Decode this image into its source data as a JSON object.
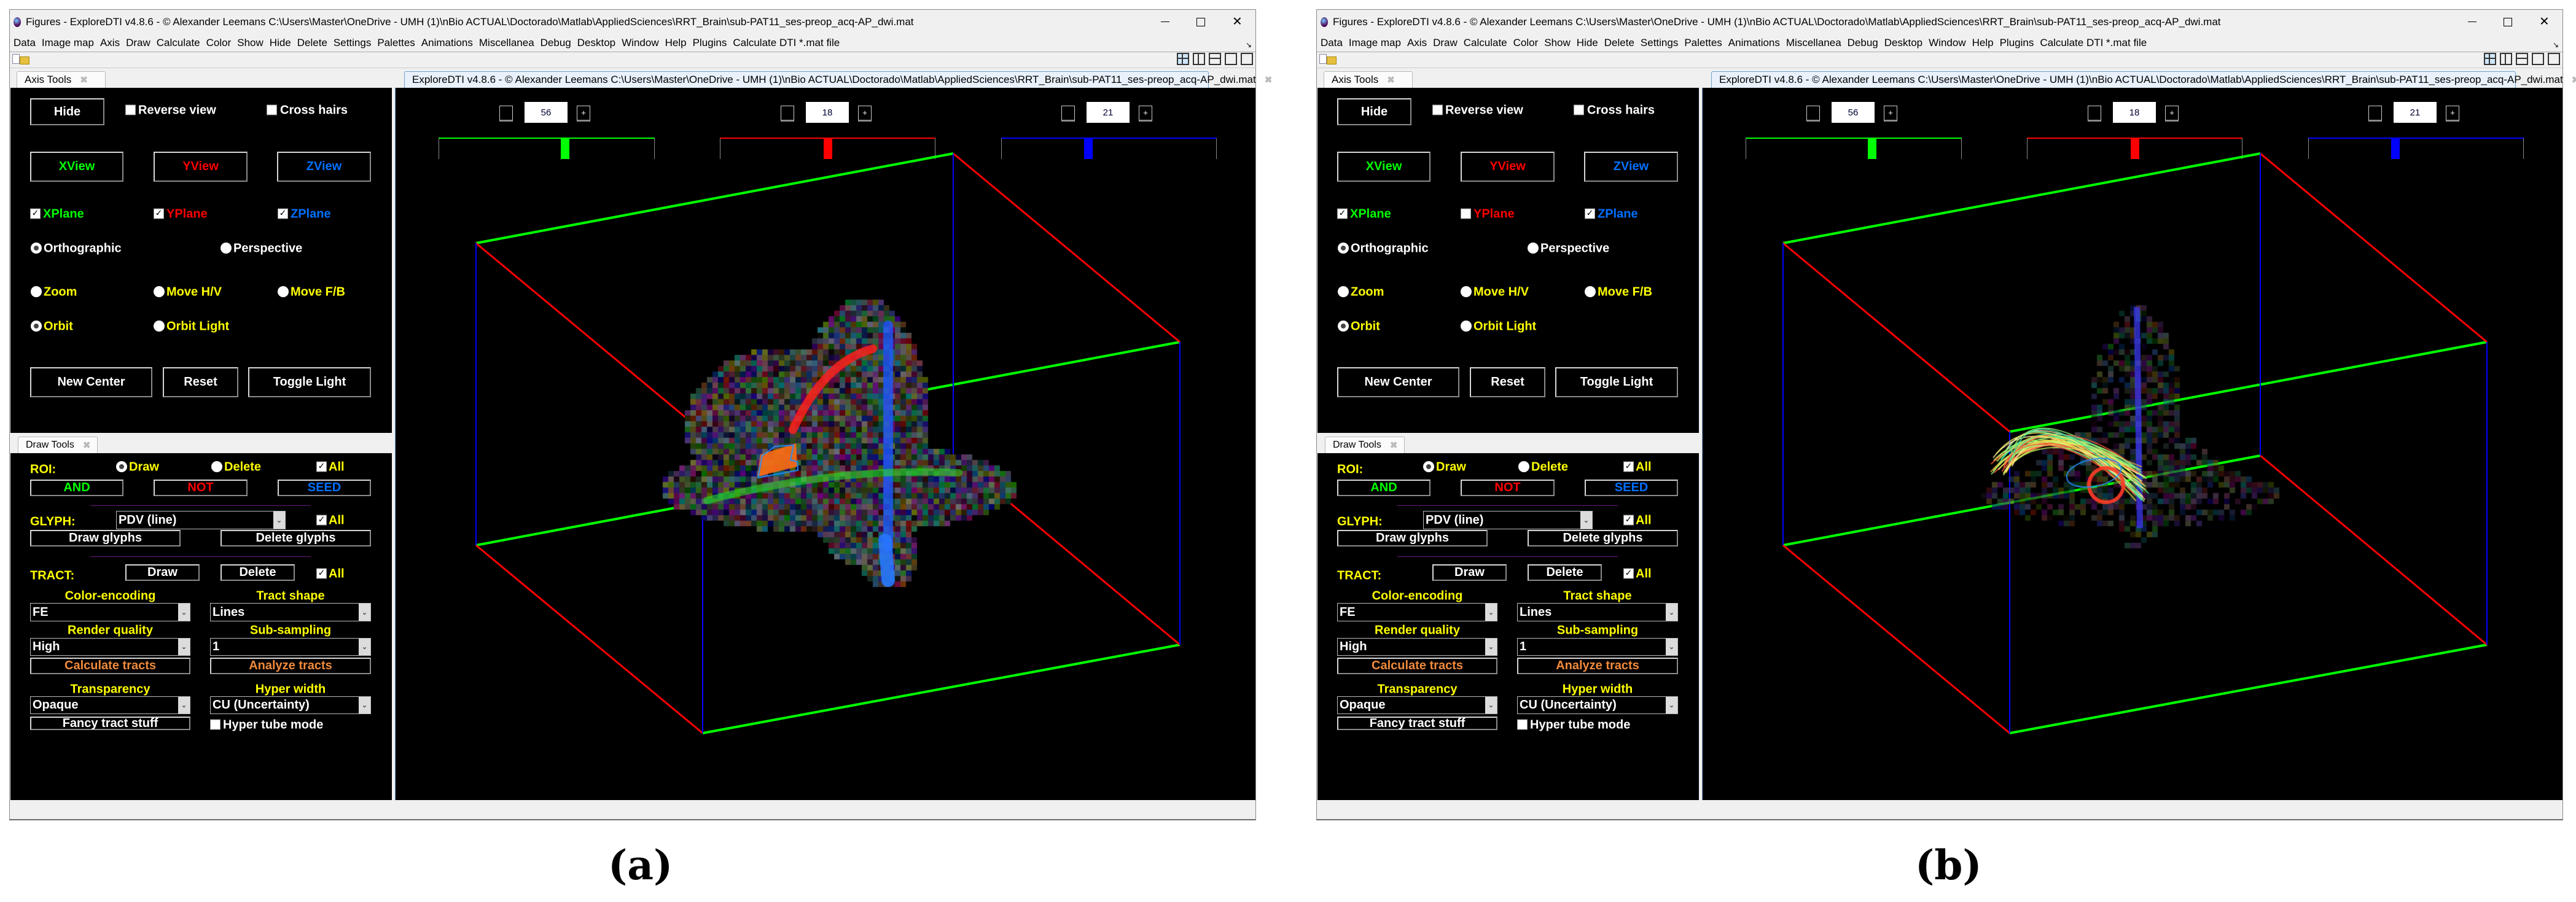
{
  "window": {
    "app_title": "Figures - ExploreDTI v4.8.6 - © Alexander Leemans   C:\\Users\\Master\\OneDrive - UMH (1)\\nBio ACTUAL\\Doctorado\\Matlab\\AppliedSciences\\RRT_Brain\\sub-PAT11_ses-preop_acq-AP_dwi.mat",
    "menu": [
      "Data",
      "Image map",
      "Axis",
      "Draw",
      "Calculate",
      "Color",
      "Show",
      "Hide",
      "Delete",
      "Settings",
      "Palettes",
      "Animations",
      "Miscellanea",
      "Debug",
      "Desktop",
      "Window",
      "Help",
      "Plugins",
      "Calculate DTI *.mat file"
    ],
    "axis_tools_tab": "Axis Tools",
    "draw_tools_tab": "Draw Tools",
    "view_tab": "ExploreDTI v4.8.6 - © Alexander Leemans   C:\\Users\\Master\\OneDrive - UMH (1)\\nBio ACTUAL\\Doctorado\\Matlab\\AppliedSciences\\RRT_Brain\\sub-PAT11_ses-preop_acq-AP_dwi.mat",
    "tab_close": "✖",
    "slice_minus": "",
    "slice_plus": "+"
  },
  "ui": {
    "axis": {
      "hide": "Hide",
      "reverse_view": "Reverse view",
      "cross_hairs": "Cross hairs",
      "xview": "XView",
      "yview": "YView",
      "zview": "ZView",
      "xplane": "XPlane",
      "yplane": "YPlane",
      "zplane": "ZPlane",
      "orthographic": "Orthographic",
      "perspective": "Perspective",
      "zoom": "Zoom",
      "move_hv": "Move H/V",
      "move_fb": "Move F/B",
      "orbit": "Orbit",
      "orbit_light": "Orbit Light",
      "new_center": "New Center",
      "reset": "Reset",
      "toggle_light": "Toggle Light"
    },
    "draw": {
      "roi": "ROI:",
      "draw": "Draw",
      "delete": "Delete",
      "all": "All",
      "and": "AND",
      "not": "NOT",
      "seed": "SEED",
      "glyph": "GLYPH:",
      "glyph_type": "PDV (line)",
      "draw_glyphs": "Draw glyphs",
      "delete_glyphs": "Delete glyphs",
      "tract": "TRACT:",
      "color_encoding": "Color-encoding",
      "color_encoding_value": "FE",
      "tract_shape": "Tract shape",
      "tract_shape_value": "Lines",
      "render_quality": "Render quality",
      "render_quality_value": "High",
      "sub_sampling": "Sub-sampling",
      "sub_sampling_value": "1",
      "calculate_tracts": "Calculate tracts",
      "analyze_tracts": "Analyze tracts",
      "transparency": "Transparency",
      "transparency_value": "Opaque",
      "hyper_width": "Hyper width",
      "hyper_width_value": "CU (Uncertainty)",
      "fancy": "Fancy tract stuff",
      "hyper_tube": "Hyper tube mode"
    }
  },
  "colors": {
    "x": "#00ff00",
    "y": "#ff0000",
    "z": "#0070ff",
    "yellow": "#ffff00",
    "orange": "#f08a3c",
    "white": "#ffffff"
  },
  "screens": [
    {
      "label": "(a)",
      "slices": [
        "56",
        "18",
        "21"
      ],
      "reverse_view": false,
      "cross_hairs": false,
      "xplane": true,
      "yplane": true,
      "zplane": true,
      "projection": "orthographic",
      "mode": "orbit",
      "roi_mode": "draw",
      "roi_all": true,
      "glyph_all": true,
      "tract_all": true,
      "hyper_tube": false,
      "scene": "slices-with-roi"
    },
    {
      "label": "(b)",
      "slices": [
        "56",
        "18",
        "21"
      ],
      "reverse_view": false,
      "cross_hairs": false,
      "xplane": true,
      "yplane": false,
      "zplane": true,
      "projection": "orthographic",
      "mode": "orbit",
      "roi_mode": "draw",
      "roi_all": true,
      "glyph_all": true,
      "tract_all": true,
      "hyper_tube": false,
      "scene": "tractography"
    }
  ]
}
